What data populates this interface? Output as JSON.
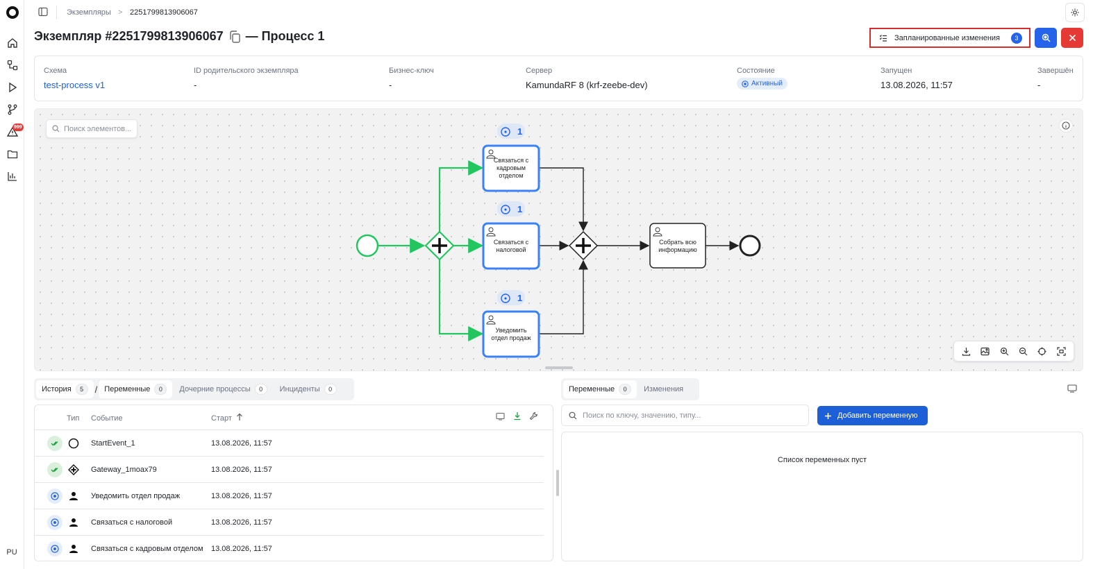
{
  "breadcrumb": {
    "parent": "Экземпляры",
    "separator": ">",
    "current": "2251799813906067"
  },
  "title": {
    "prefix": "Экземпляр #2251799813906067",
    "suffix": "— Процесс 1"
  },
  "actions": {
    "planned_label": "Запланированные изменения",
    "planned_count": "3"
  },
  "rail": {
    "notification_badge": "999",
    "user_initials": "PU"
  },
  "info": {
    "scheme": {
      "label": "Схема",
      "value": "test-process v1"
    },
    "parent": {
      "label": "ID родительского экземпляра",
      "value": "-"
    },
    "business_key": {
      "label": "Бизнес-ключ",
      "value": "-"
    },
    "server": {
      "label": "Сервер",
      "value": "KamundaRF 8 (krf-zeebe-dev)"
    },
    "state": {
      "label": "Состояние",
      "value": "Активный"
    },
    "started": {
      "label": "Запущен",
      "value": "13.08.2026, 11:57"
    },
    "finished": {
      "label": "Завершён",
      "value": "-"
    }
  },
  "canvas": {
    "search_placeholder": "Поиск элементов...",
    "tasks": {
      "hr": "Связаться с кадровым отделом",
      "tax": "Связаться с налоговой",
      "sales": "Уведомить отдел продаж",
      "collect": "Собрать всю информацию"
    },
    "token_counts": {
      "hr": "1",
      "tax": "1",
      "sales": "1"
    }
  },
  "left_tabs": [
    {
      "label": "История",
      "count": "5"
    },
    {
      "label": "Переменные",
      "count": "0"
    },
    {
      "label": "Дочерние процессы",
      "count": "0"
    },
    {
      "label": "Инциденты",
      "count": "0"
    }
  ],
  "left_tab_separator": "/",
  "history": {
    "headers": {
      "type": "Тип",
      "event": "Событие",
      "start": "Старт"
    },
    "rows": [
      {
        "status": "completed",
        "type_icon": "start-event-icon",
        "event": "StartEvent_1",
        "start": "13.08.2026, 11:57"
      },
      {
        "status": "completed",
        "type_icon": "parallel-gateway-icon",
        "event": "Gateway_1moax79",
        "start": "13.08.2026, 11:57"
      },
      {
        "status": "active",
        "type_icon": "user-task-icon",
        "event": "Уведомить отдел продаж",
        "start": "13.08.2026, 11:57"
      },
      {
        "status": "active",
        "type_icon": "user-task-icon",
        "event": "Связаться с налоговой",
        "start": "13.08.2026, 11:57"
      },
      {
        "status": "active",
        "type_icon": "user-task-icon",
        "event": "Связаться с кадровым отделом",
        "start": "13.08.2026, 11:57"
      }
    ]
  },
  "right_tabs": [
    {
      "label": "Переменные",
      "count": "0"
    },
    {
      "label": "Изменения"
    }
  ],
  "variables": {
    "search_placeholder": "Поиск по ключу, значению, типу...",
    "add_label": "Добавить переменную",
    "empty_text": "Список переменных пуст"
  },
  "colors": {
    "accent": "#2563eb",
    "danger": "#e53935",
    "flow_active": "#22c55e",
    "task_active": "#3b82f6"
  }
}
